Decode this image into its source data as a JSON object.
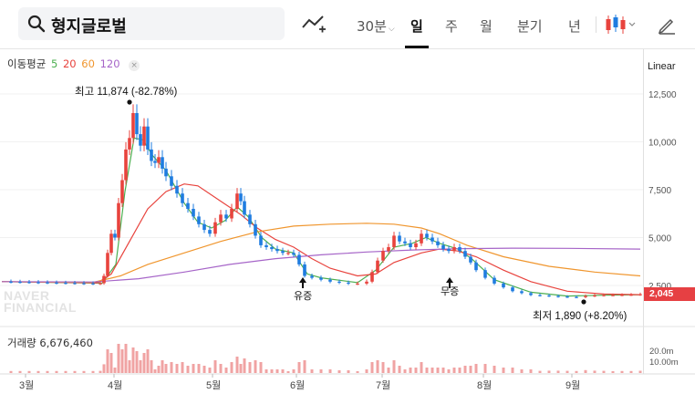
{
  "search": {
    "query": "형지글로벌"
  },
  "toolbar": {
    "interval_label": "30분",
    "day_label": "일",
    "week_label": "주",
    "month_label": "월",
    "quarter_label": "분기",
    "year_label": "년"
  },
  "legend": {
    "ma_title": "이동평균",
    "ma_periods": [
      "5",
      "20",
      "60",
      "120"
    ],
    "ma_colors": [
      "#4caf50",
      "#e8433d",
      "#f0962e",
      "#a665c8"
    ],
    "close": "×"
  },
  "scale": {
    "label": "Linear"
  },
  "watermark": {
    "line1": "NAVER",
    "line2": "FINANCIAL"
  },
  "annotations": {
    "high": "최고 11,874 (-82.78%)",
    "low": "최저 1,890 (+8.20%)",
    "rights_paid": "유증",
    "rights_free": "무증"
  },
  "current_price": "2,045",
  "volume": {
    "label": "거래량 6,676,460"
  },
  "colors": {
    "up": "#e8433d",
    "down": "#1f7ce0",
    "volume": "#f0a3a3"
  },
  "chart_data": {
    "type": "candlestick",
    "x_labels": [
      "3월",
      "4월",
      "5월",
      "6월",
      "7월",
      "8월",
      "9월"
    ],
    "y_ticks": [
      "12,500",
      "10,000",
      "7,500",
      "5,000",
      "2,500"
    ],
    "y_range": [
      0,
      13000
    ],
    "volume_ticks": [
      "20.0m",
      "10.00m"
    ],
    "price_series": [
      [
        0,
        2700
      ],
      [
        10,
        2690
      ],
      [
        20,
        2680
      ],
      [
        30,
        2670
      ],
      [
        40,
        2660
      ],
      [
        50,
        2650
      ],
      [
        60,
        2640
      ],
      [
        70,
        2630
      ],
      [
        80,
        2620
      ],
      [
        90,
        2610
      ],
      [
        100,
        2600
      ],
      [
        108,
        2620
      ],
      [
        112,
        3000
      ],
      [
        116,
        4200
      ],
      [
        120,
        5200
      ],
      [
        124,
        5000
      ],
      [
        128,
        6800
      ],
      [
        132,
        8000
      ],
      [
        136,
        9600
      ],
      [
        140,
        10200
      ],
      [
        144,
        11500
      ],
      [
        148,
        10400
      ],
      [
        152,
        9800
      ],
      [
        156,
        10800
      ],
      [
        160,
        9600
      ],
      [
        164,
        9000
      ],
      [
        168,
        8900
      ],
      [
        172,
        9200
      ],
      [
        176,
        8600
      ],
      [
        180,
        8200
      ],
      [
        186,
        7700
      ],
      [
        192,
        7300
      ],
      [
        198,
        6800
      ],
      [
        204,
        6500
      ],
      [
        210,
        6100
      ],
      [
        216,
        5700
      ],
      [
        222,
        5400
      ],
      [
        228,
        5200
      ],
      [
        234,
        5800
      ],
      [
        240,
        6200
      ],
      [
        246,
        6000
      ],
      [
        252,
        6500
      ],
      [
        258,
        7300
      ],
      [
        262,
        6900
      ],
      [
        266,
        6200
      ],
      [
        272,
        5700
      ],
      [
        278,
        5100
      ],
      [
        284,
        4600
      ],
      [
        290,
        4500
      ],
      [
        296,
        4400
      ],
      [
        302,
        4300
      ],
      [
        308,
        4200
      ],
      [
        314,
        4200
      ],
      [
        320,
        4100
      ],
      [
        326,
        3600
      ],
      [
        332,
        3000
      ],
      [
        340,
        2900
      ],
      [
        350,
        2800
      ],
      [
        360,
        2700
      ],
      [
        370,
        2650
      ],
      [
        380,
        2600
      ],
      [
        390,
        2600
      ],
      [
        400,
        2700
      ],
      [
        406,
        3200
      ],
      [
        412,
        3800
      ],
      [
        418,
        4300
      ],
      [
        424,
        4500
      ],
      [
        430,
        5100
      ],
      [
        436,
        4800
      ],
      [
        442,
        4700
      ],
      [
        448,
        4500
      ],
      [
        454,
        4700
      ],
      [
        460,
        5200
      ],
      [
        466,
        5000
      ],
      [
        472,
        4800
      ],
      [
        478,
        4600
      ],
      [
        484,
        4400
      ],
      [
        490,
        4300
      ],
      [
        496,
        4500
      ],
      [
        502,
        4300
      ],
      [
        508,
        4000
      ],
      [
        514,
        3700
      ],
      [
        520,
        3300
      ],
      [
        530,
        2900
      ],
      [
        540,
        2600
      ],
      [
        550,
        2400
      ],
      [
        560,
        2200
      ],
      [
        570,
        2100
      ],
      [
        580,
        2000
      ],
      [
        590,
        1980
      ],
      [
        600,
        1950
      ],
      [
        610,
        1920
      ],
      [
        620,
        1900
      ],
      [
        630,
        1890
      ],
      [
        640,
        1950
      ],
      [
        650,
        1980
      ],
      [
        660,
        2000
      ],
      [
        670,
        2000
      ],
      [
        680,
        2010
      ],
      [
        690,
        2020
      ],
      [
        700,
        2045
      ]
    ],
    "ma5": [
      [
        0,
        2700
      ],
      [
        110,
        2620
      ],
      [
        125,
        3600
      ],
      [
        135,
        7400
      ],
      [
        145,
        10200
      ],
      [
        155,
        10100
      ],
      [
        165,
        9300
      ],
      [
        180,
        8500
      ],
      [
        200,
        6800
      ],
      [
        215,
        5800
      ],
      [
        230,
        5500
      ],
      [
        245,
        5900
      ],
      [
        258,
        6600
      ],
      [
        270,
        6100
      ],
      [
        285,
        5000
      ],
      [
        300,
        4400
      ],
      [
        320,
        4200
      ],
      [
        335,
        3100
      ],
      [
        350,
        2900
      ],
      [
        390,
        2650
      ],
      [
        410,
        3300
      ],
      [
        430,
        4500
      ],
      [
        450,
        4700
      ],
      [
        465,
        5000
      ],
      [
        480,
        4700
      ],
      [
        500,
        4400
      ],
      [
        515,
        3900
      ],
      [
        540,
        2800
      ],
      [
        580,
        2150
      ],
      [
        620,
        1950
      ],
      [
        660,
        1990
      ],
      [
        700,
        2020
      ]
    ],
    "ma20": [
      [
        0,
        2700
      ],
      [
        105,
        2640
      ],
      [
        120,
        3100
      ],
      [
        140,
        4800
      ],
      [
        160,
        6500
      ],
      [
        180,
        7400
      ],
      [
        200,
        7800
      ],
      [
        215,
        7700
      ],
      [
        240,
        6900
      ],
      [
        262,
        6200
      ],
      [
        280,
        5500
      ],
      [
        300,
        4900
      ],
      [
        320,
        4500
      ],
      [
        340,
        3900
      ],
      [
        360,
        3400
      ],
      [
        390,
        3000
      ],
      [
        410,
        3100
      ],
      [
        430,
        3700
      ],
      [
        460,
        4200
      ],
      [
        480,
        4400
      ],
      [
        500,
        4300
      ],
      [
        520,
        4000
      ],
      [
        550,
        3300
      ],
      [
        580,
        2700
      ],
      [
        620,
        2200
      ],
      [
        660,
        2050
      ],
      [
        700,
        2020
      ]
    ],
    "ma60": [
      [
        0,
        2700
      ],
      [
        100,
        2660
      ],
      [
        130,
        3000
      ],
      [
        160,
        3600
      ],
      [
        200,
        4200
      ],
      [
        240,
        4800
      ],
      [
        280,
        5300
      ],
      [
        320,
        5600
      ],
      [
        360,
        5700
      ],
      [
        400,
        5750
      ],
      [
        430,
        5700
      ],
      [
        460,
        5500
      ],
      [
        480,
        5200
      ],
      [
        510,
        4600
      ],
      [
        550,
        4000
      ],
      [
        600,
        3500
      ],
      [
        650,
        3200
      ],
      [
        700,
        3000
      ]
    ],
    "ma120": [
      [
        0,
        2700
      ],
      [
        100,
        2680
      ],
      [
        150,
        2850
      ],
      [
        200,
        3200
      ],
      [
        250,
        3600
      ],
      [
        300,
        3900
      ],
      [
        350,
        4100
      ],
      [
        400,
        4250
      ],
      [
        450,
        4350
      ],
      [
        500,
        4420
      ],
      [
        560,
        4450
      ],
      [
        620,
        4440
      ],
      [
        700,
        4400
      ]
    ]
  }
}
